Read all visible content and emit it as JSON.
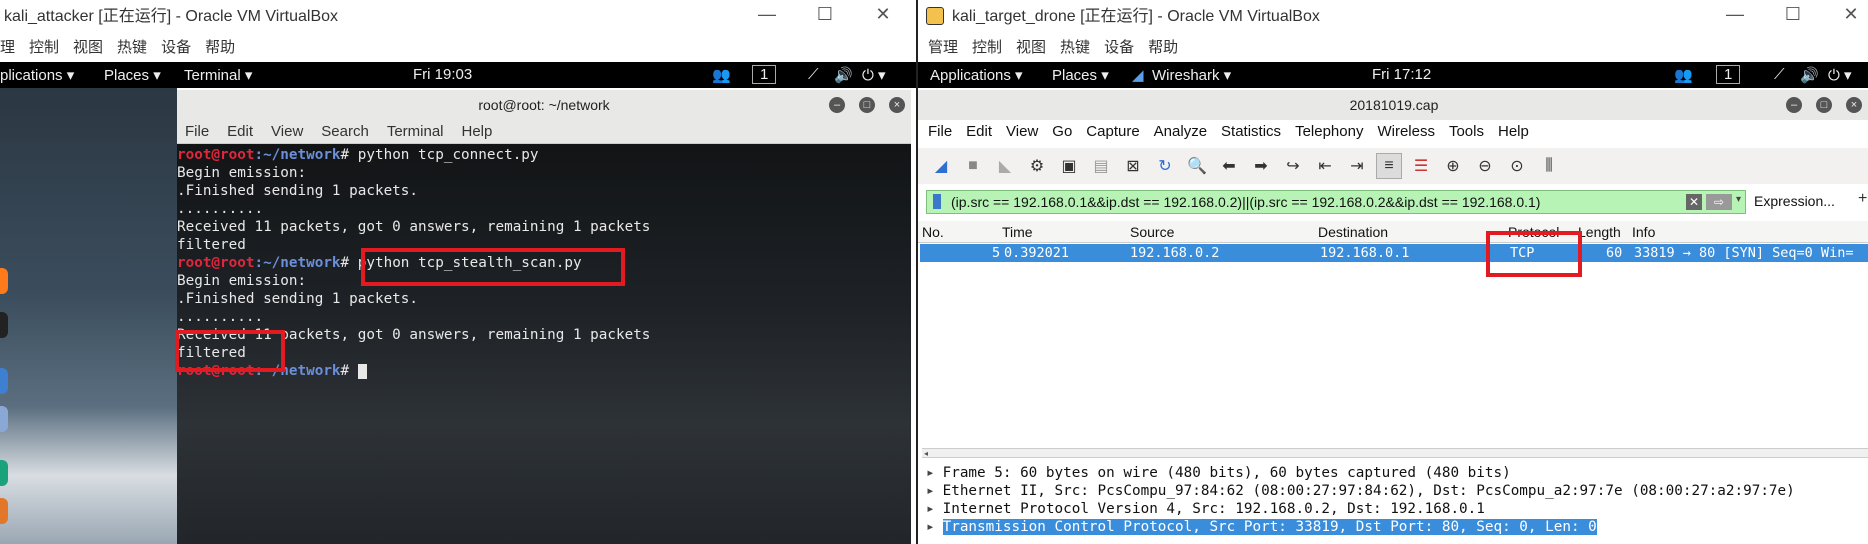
{
  "left": {
    "window_title": "kali_attacker [正在运行] - Oracle VM VirtualBox",
    "vb_menu": [
      "理",
      "控制",
      "视图",
      "热键",
      "设备",
      "帮助"
    ],
    "topbar": {
      "applications": "plications ▾",
      "places": "Places ▾",
      "terminal": "Terminal ▾",
      "clock": "Fri 19:03",
      "workspace": "1"
    },
    "terminal": {
      "title": "root@root: ~/network",
      "menu": [
        "File",
        "Edit",
        "View",
        "Search",
        "Terminal",
        "Help"
      ],
      "lines": [
        {
          "prompt_user": "root@root",
          "prompt_path": ":~/network",
          "cmd": "# python tcp_connect.py"
        },
        {
          "text": "Begin emission:"
        },
        {
          "text": ".Finished sending 1 packets."
        },
        {
          "text": ".........."
        },
        {
          "text": "Received 11 packets, got 0 answers, remaining 1 packets"
        },
        {
          "text": "filtered"
        },
        {
          "prompt_user": "root@root",
          "prompt_path": ":~/network",
          "cmd": "# python tcp_stealth_scan.py"
        },
        {
          "text": "Begin emission:"
        },
        {
          "text": ".Finished sending 1 packets."
        },
        {
          "text": ".........."
        },
        {
          "text": "Received 11 packets, got 0 answers, remaining 1 packets"
        },
        {
          "text": "filtered"
        },
        {
          "prompt_user": "root@root",
          "prompt_path": ":~/network",
          "cmd": "# "
        }
      ]
    }
  },
  "right": {
    "window_title": "kali_target_drone [正在运行] - Oracle VM VirtualBox",
    "vb_menu": [
      "管理",
      "控制",
      "视图",
      "热键",
      "设备",
      "帮助"
    ],
    "topbar": {
      "applications": "Applications ▾",
      "places": "Places ▾",
      "wireshark": "Wireshark ▾",
      "clock": "Fri 17:12",
      "workspace": "1"
    },
    "wireshark": {
      "title": "20181019.cap",
      "menu": [
        "File",
        "Edit",
        "View",
        "Go",
        "Capture",
        "Analyze",
        "Statistics",
        "Telephony",
        "Wireless",
        "Tools",
        "Help"
      ],
      "filter": "(ip.src == 192.168.0.1&&ip.dst == 192.168.0.2)||(ip.src == 192.168.0.2&&ip.dst == 192.168.0.1)",
      "expression_label": "Expression...",
      "columns": [
        "No.",
        "Time",
        "Source",
        "Destination",
        "Protocol",
        "Length",
        "Info"
      ],
      "packets": [
        {
          "no": "5",
          "time": "0.392021",
          "source": "192.168.0.2",
          "destination": "192.168.0.1",
          "protocol": "TCP",
          "length": "60",
          "info": "33819 → 80 [SYN] Seq=0 Win="
        }
      ],
      "details": [
        "Frame 5: 60 bytes on wire (480 bits), 60 bytes captured (480 bits)",
        "Ethernet II, Src: PcsCompu_97:84:62 (08:00:27:97:84:62), Dst: PcsCompu_a2:97:7e (08:00:27:a2:97:7e)",
        "Internet Protocol Version 4, Src: 192.168.0.2, Dst: 192.168.0.1",
        "Transmission Control Protocol, Src Port: 33819, Dst Port: 80, Seq: 0, Len: 0"
      ]
    }
  },
  "colors": {
    "highlight_box": "#e21b23",
    "selected_row": "#3a8ddb",
    "filter_valid": "#b6f3b4"
  }
}
